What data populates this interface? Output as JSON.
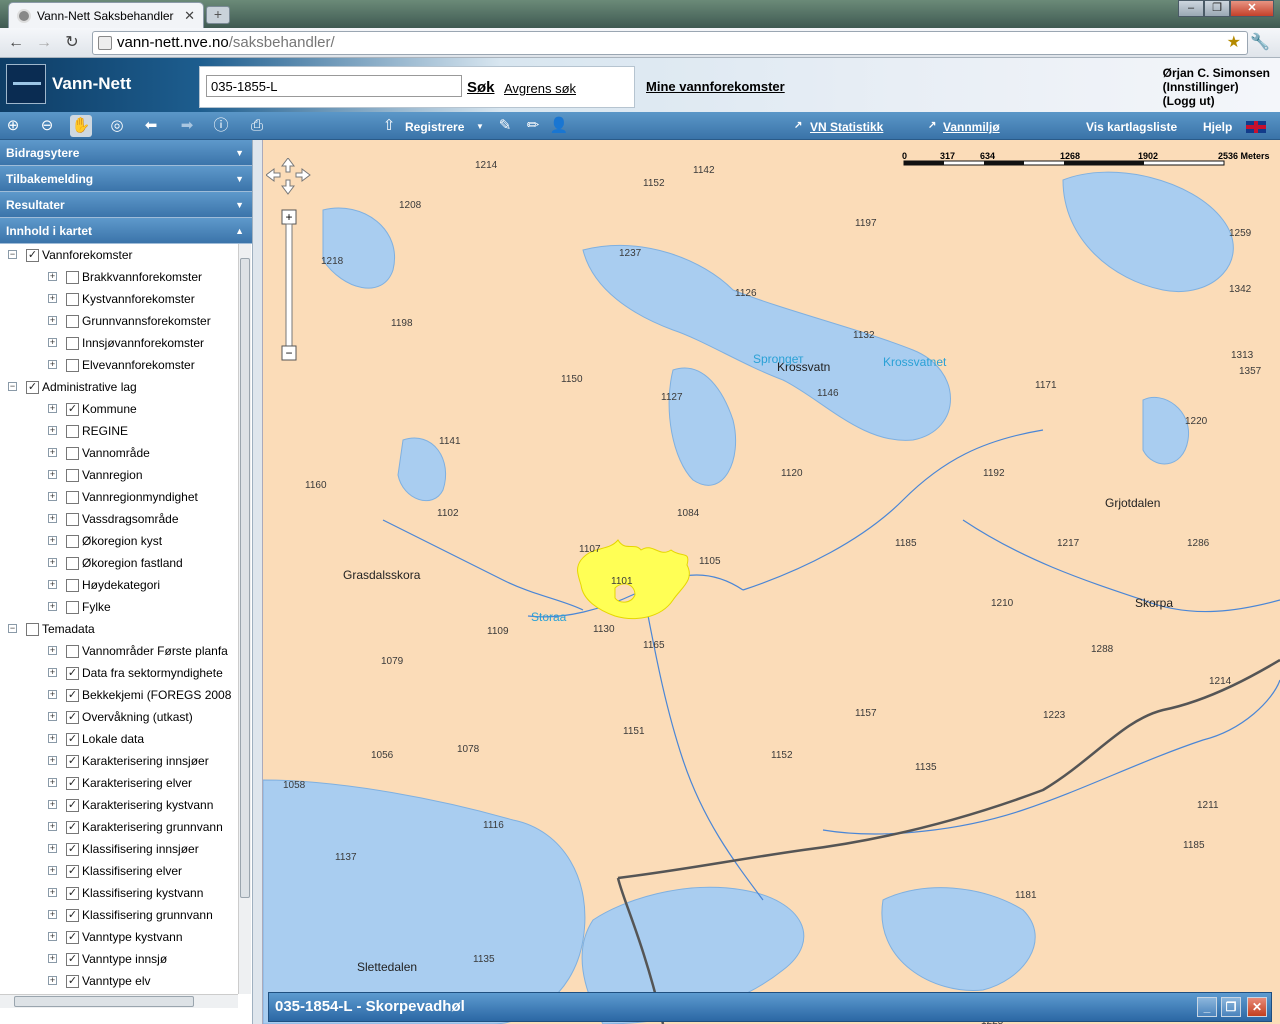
{
  "browser": {
    "tab_title": "Vann-Nett Saksbehandler",
    "url_host": "vann-nett.nve.no",
    "url_path": "/saksbehandler/"
  },
  "header": {
    "app_name": "Vann-Nett",
    "search_value": "035-1855-L",
    "search_button": "Søk",
    "refine_link": "Avgrens søk",
    "my_waterbodies": "Mine vannforekomster",
    "user_name": "Ørjan C. Simonsen",
    "settings": "(Innstillinger)",
    "logout": "(Logg ut)"
  },
  "toolbar": {
    "register": "Registrere",
    "stats": "VN Statistikk",
    "env": "Vannmiljø",
    "layer_list": "Vis kartlagsliste",
    "help": "Hjelp"
  },
  "sidebar": {
    "panels": [
      "Bidragsytere",
      "Tilbakemelding",
      "Resultater",
      "Innhold i kartet"
    ],
    "tree": [
      {
        "level": 0,
        "expanded": true,
        "checked": true,
        "label": "Vannforekomster"
      },
      {
        "level": 1,
        "expanded": false,
        "checked": false,
        "label": "Brakkvannforekomster"
      },
      {
        "level": 1,
        "expanded": false,
        "checked": false,
        "label": "Kystvannforekomster"
      },
      {
        "level": 1,
        "expanded": false,
        "checked": false,
        "label": "Grunnvannsforekomster"
      },
      {
        "level": 1,
        "expanded": false,
        "checked": false,
        "label": "Innsjøvannforekomster"
      },
      {
        "level": 1,
        "expanded": false,
        "checked": false,
        "label": "Elvevannforekomster"
      },
      {
        "level": 0,
        "expanded": true,
        "checked": true,
        "label": "Administrative lag"
      },
      {
        "level": 1,
        "expanded": false,
        "checked": true,
        "label": "Kommune"
      },
      {
        "level": 1,
        "expanded": false,
        "checked": false,
        "label": "REGINE"
      },
      {
        "level": 1,
        "expanded": false,
        "checked": false,
        "label": "Vannområde"
      },
      {
        "level": 1,
        "expanded": false,
        "checked": false,
        "label": "Vannregion"
      },
      {
        "level": 1,
        "expanded": false,
        "checked": false,
        "label": "Vannregionmyndighet"
      },
      {
        "level": 1,
        "expanded": false,
        "checked": false,
        "label": "Vassdragsområde"
      },
      {
        "level": 1,
        "expanded": false,
        "checked": false,
        "label": "Økoregion kyst"
      },
      {
        "level": 1,
        "expanded": false,
        "checked": false,
        "label": "Økoregion fastland"
      },
      {
        "level": 1,
        "expanded": false,
        "checked": false,
        "label": "Høydekategori"
      },
      {
        "level": 1,
        "expanded": false,
        "checked": false,
        "label": "Fylke"
      },
      {
        "level": 0,
        "expanded": true,
        "checked": false,
        "label": "Temadata"
      },
      {
        "level": 1,
        "expanded": false,
        "checked": false,
        "label": "Vannområder Første planfa"
      },
      {
        "level": 1,
        "expanded": false,
        "checked": true,
        "label": "Data fra sektormyndighete"
      },
      {
        "level": 1,
        "expanded": false,
        "checked": true,
        "label": "Bekkekjemi (FOREGS 2008"
      },
      {
        "level": 1,
        "expanded": false,
        "checked": true,
        "label": "Overvåkning (utkast)"
      },
      {
        "level": 1,
        "expanded": false,
        "checked": true,
        "label": "Lokale data"
      },
      {
        "level": 1,
        "expanded": false,
        "checked": true,
        "label": "Karakterisering innsjøer"
      },
      {
        "level": 1,
        "expanded": false,
        "checked": true,
        "label": "Karakterisering elver"
      },
      {
        "level": 1,
        "expanded": false,
        "checked": true,
        "label": "Karakterisering kystvann"
      },
      {
        "level": 1,
        "expanded": false,
        "checked": true,
        "label": "Karakterisering grunnvann"
      },
      {
        "level": 1,
        "expanded": false,
        "checked": true,
        "label": "Klassifisering innsjøer"
      },
      {
        "level": 1,
        "expanded": false,
        "checked": true,
        "label": "Klassifisering elver"
      },
      {
        "level": 1,
        "expanded": false,
        "checked": true,
        "label": "Klassifisering kystvann"
      },
      {
        "level": 1,
        "expanded": false,
        "checked": true,
        "label": "Klassifisering grunnvann"
      },
      {
        "level": 1,
        "expanded": false,
        "checked": true,
        "label": "Vanntype kystvann"
      },
      {
        "level": 1,
        "expanded": false,
        "checked": true,
        "label": "Vanntype innsjø"
      },
      {
        "level": 1,
        "expanded": false,
        "checked": true,
        "label": "Vanntype elv"
      }
    ]
  },
  "map": {
    "scale_ticks": [
      "0",
      "317",
      "634",
      "1268",
      "1902",
      "2536 Meters"
    ],
    "place_names": [
      "Grasdalsskora",
      "Grjotdalen",
      "Skorpa",
      "Krossvatn",
      "Slettedalen"
    ],
    "water_names": [
      "Sprongет",
      "Krossvatnet",
      "Storaa"
    ],
    "heights": [
      "1214",
      "1152",
      "1142",
      "1208",
      "1237",
      "1197",
      "1259",
      "1218",
      "1126",
      "1342",
      "1198",
      "1132",
      "1313",
      "1357",
      "1150",
      "1146",
      "1171",
      "1127",
      "1141",
      "1220",
      "1160",
      "1120",
      "1192",
      "1102",
      "1084",
      "1185",
      "1217",
      "1286",
      "1107",
      "1101",
      "1105",
      "1109",
      "1130",
      "1210",
      "1079",
      "1165",
      "1288",
      "1157",
      "1214",
      "1223",
      "1151",
      "1078",
      "1056",
      "1152",
      "1135",
      "1058",
      "1116",
      "1211",
      "1137",
      "1185",
      "1181",
      "1225",
      "1135"
    ],
    "selected_color": "#ffff55",
    "water_color": "#a9cdf0",
    "land_color": "#fbdcb8"
  },
  "bottom_panel": {
    "title": "035-1854-L - Skorpevadhøl"
  }
}
